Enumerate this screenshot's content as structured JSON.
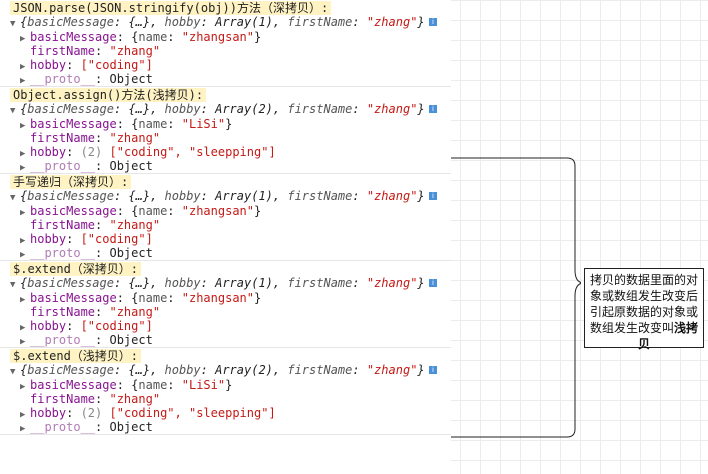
{
  "sections": [
    {
      "title": "JSON.parse(JSON.stringify(obj))方法（深拷贝）:",
      "summary": {
        "basicMessage": "{…}",
        "hobby": "Array(1)",
        "firstName": "\"zhang\""
      },
      "basicMessage_name": "\"zhangsan\"",
      "firstName": "\"zhang\"",
      "hobby_count": "",
      "hobby_items": "[\"coding\"]"
    },
    {
      "title": "Object.assign()方法(浅拷贝):",
      "summary": {
        "basicMessage": "{…}",
        "hobby": "Array(2)",
        "firstName": "\"zhang\""
      },
      "basicMessage_name": "\"LiSi\"",
      "firstName": "\"zhang\"",
      "hobby_count": "(2)",
      "hobby_items": "[\"coding\", \"sleepping\"]"
    },
    {
      "title": "手写递归（深拷贝）:",
      "summary": {
        "basicMessage": "{…}",
        "hobby": "Array(1)",
        "firstName": "\"zhang\""
      },
      "basicMessage_name": "\"zhangsan\"",
      "firstName": "\"zhang\"",
      "hobby_count": "",
      "hobby_items": "[\"coding\"]"
    },
    {
      "title": "$.extend（深拷贝）:",
      "summary": {
        "basicMessage": "{…}",
        "hobby": "Array(1)",
        "firstName": "\"zhang\""
      },
      "basicMessage_name": "\"zhangsan\"",
      "firstName": "\"zhang\"",
      "hobby_count": "",
      "hobby_items": "[\"coding\"]"
    },
    {
      "title": "$.extend（浅拷贝）:",
      "summary": {
        "basicMessage": "{…}",
        "hobby": "Array(2)",
        "firstName": "\"zhang\""
      },
      "basicMessage_name": "\"LiSi\"",
      "firstName": "\"zhang\"",
      "hobby_count": "(2)",
      "hobby_items": "[\"coding\", \"sleepping\"]"
    }
  ],
  "labels": {
    "basicMessage": "basicMessage",
    "name_key": "name",
    "firstName": "firstName",
    "hobby": "hobby",
    "proto": "__proto__",
    "object": "Object",
    "expand_caret": "▼",
    "collapsed_caret": "▶",
    "info_icon": "i"
  },
  "note": {
    "text": "拷贝的数据里面的对象或数组发生改变后引起原数据的对象或数组发生改变叫",
    "bold": "浅拷贝"
  },
  "colors": {
    "title_bg": "#fff3c4",
    "string": "#c41a16",
    "key": "#881391",
    "info_icon": "#4a90d9"
  }
}
